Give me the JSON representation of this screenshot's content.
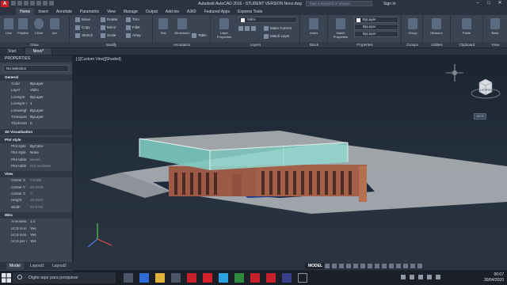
{
  "titlebar": {
    "title": "Autodesk AutoCAD 2016 - STUDENT VERSION    Novo.dwg",
    "search_placeholder": "Type a keyword or phrase",
    "signin": "Sign In",
    "logo": "A"
  },
  "ribbon_tabs": [
    "Home",
    "Insert",
    "Annotate",
    "Parametric",
    "View",
    "Manage",
    "Output",
    "Add-ins",
    "A360",
    "Featured Apps",
    "Express Tools"
  ],
  "ribbon": {
    "draw": {
      "label": "Draw",
      "line": "Line",
      "polyline": "Polyline",
      "circle": "Circle",
      "arc": "Arc"
    },
    "modify": {
      "label": "Modify",
      "move": "Move",
      "rotate": "Rotate",
      "trim": "Trim",
      "copy": "Copy",
      "mirror": "Mirror",
      "fillet": "Fillet",
      "stretch": "Stretch",
      "scale": "Scale",
      "array": "Array"
    },
    "annotation": {
      "label": "Annotation",
      "text": "Text",
      "dimension": "Dimension",
      "table": "Table"
    },
    "layers": {
      "label": "Layers",
      "layer_properties": "Layer Properties",
      "current_layer": "Vidro",
      "make_current": "Make Current",
      "match_layer": "Match Layer"
    },
    "block": {
      "label": "Block",
      "insert": "Insert"
    },
    "properties": {
      "label": "Properties",
      "match": "Match Properties",
      "color": "ByLayer",
      "linetype": "ByLayer",
      "lineweight": "ByLayer"
    },
    "groups": {
      "label": "Groups",
      "group": "Group"
    },
    "utilities": {
      "label": "Utilities",
      "measure": "Measure"
    },
    "clipboard": {
      "label": "Clipboard",
      "paste": "Paste"
    },
    "view": {
      "label": "View",
      "base": "Base"
    }
  },
  "filetabs": [
    "Start",
    "Novo*"
  ],
  "properties_palette": {
    "header": "PROPERTIES",
    "selection": "No selection",
    "general_title": "General",
    "general": [
      {
        "k": "Color",
        "v": "ByLayer"
      },
      {
        "k": "Layer",
        "v": "Vidro"
      },
      {
        "k": "Linetype",
        "v": "ByLayer"
      },
      {
        "k": "Linetype s...",
        "v": "1"
      },
      {
        "k": "Lineweight",
        "v": "ByLayer"
      },
      {
        "k": "Transparen...",
        "v": "ByLayer"
      },
      {
        "k": "Thickness",
        "v": "0"
      }
    ],
    "viz_title": "3D Visualization",
    "plot_title": "Plot style",
    "plot": [
      {
        "k": "Plot style",
        "v": "ByColor"
      },
      {
        "k": "Plot style t...",
        "v": "None"
      },
      {
        "k": "Plot table...",
        "v": "Model"
      },
      {
        "k": "Plot table t...",
        "v": "Not available"
      }
    ],
    "view_title": "View",
    "view": [
      {
        "k": "Center X",
        "v": "0.6406"
      },
      {
        "k": "Center Y",
        "v": "68.6938"
      },
      {
        "k": "Center Z",
        "v": "0"
      },
      {
        "k": "Height",
        "v": "29.8503"
      },
      {
        "k": "Width",
        "v": "50.8725"
      }
    ],
    "misc_title": "Misc",
    "misc": [
      {
        "k": "Annotatio...",
        "v": "1:1"
      },
      {
        "k": "UCS icon On",
        "v": "Yes"
      },
      {
        "k": "UCS icon a...",
        "v": "Yes"
      },
      {
        "k": "UCS per vi...",
        "v": "Yes"
      },
      {
        "k": "UCS Name",
        "v": ""
      }
    ]
  },
  "viewport": {
    "label": "[-][Custom View][Shaded]",
    "cube_left": "LEFT",
    "cube_front": "FRONT",
    "wcs": "WCS"
  },
  "layout_tabs": [
    "Model",
    "Layout1",
    "Layout2"
  ],
  "status": {
    "model": "MODEL"
  },
  "taskbar": {
    "search_placeholder": "Digite aqui para pesquisar",
    "time": "00:07",
    "date": "30/04/2020"
  }
}
